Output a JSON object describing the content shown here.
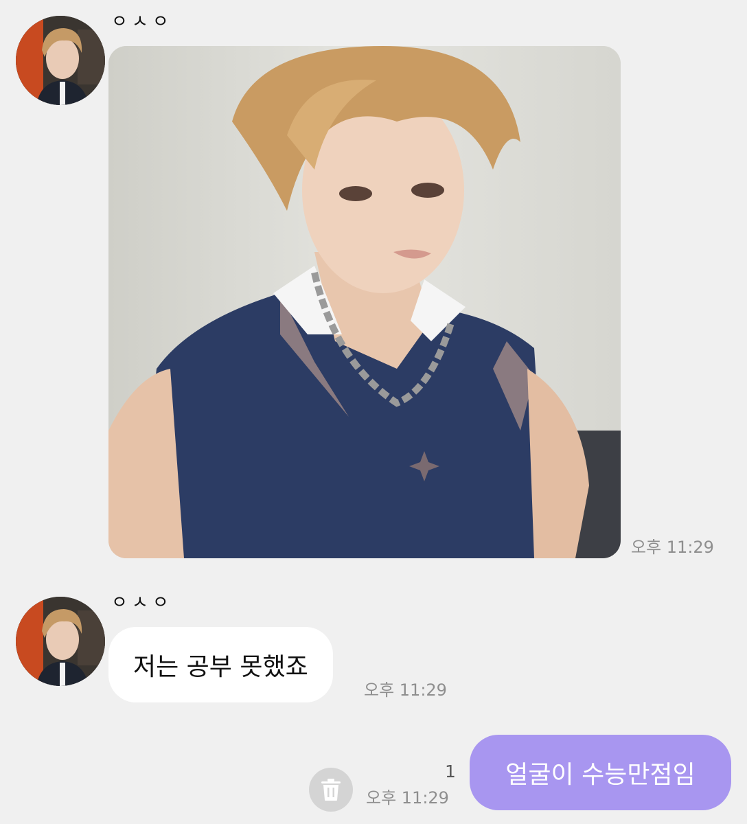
{
  "messages": [
    {
      "sender": "ㅇㅅㅇ",
      "type": "image",
      "time": "오후 11:29"
    },
    {
      "sender": "ㅇㅅㅇ",
      "type": "text",
      "text": "저는 공부 못했죠",
      "time": "오후 11:29"
    },
    {
      "sender": "me",
      "type": "text",
      "text": "얼굴이 수능만점임",
      "time": "오후 11:29",
      "unread_count": "1"
    }
  ],
  "colors": {
    "background": "#f0f0f0",
    "incoming_bubble": "#ffffff",
    "outgoing_bubble": "#a896f0",
    "timestamp": "#8e8e8e"
  },
  "icons": {
    "delete": "trash-icon"
  }
}
